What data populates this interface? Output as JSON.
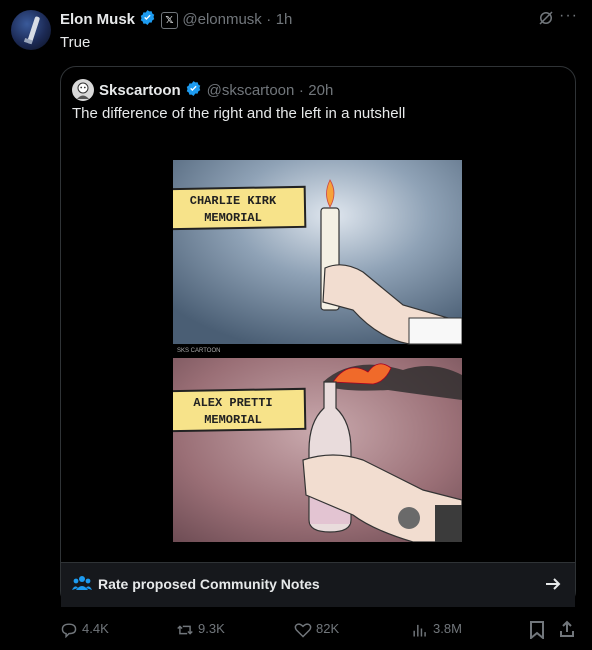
{
  "tweet": {
    "author_name": "Elon Musk",
    "x_badge": "𝕏",
    "handle": "@elonmusk",
    "dot": "·",
    "time": "1h",
    "text": "True",
    "more_icon": "ellipsis-icon",
    "grok_icon": "grok-icon"
  },
  "quote": {
    "author_name": "Skscartoon",
    "handle": "@skscartoon",
    "dot": "·",
    "time": "20h",
    "text": "The difference of the right and the left in a nutshell",
    "comic": {
      "panel1_label_line1": "CHARLIE KIRK",
      "panel1_label_line2": "MEMORIAL",
      "watermark": "SKS CARTOON",
      "panel2_label_line1": "ALEX PRETTI",
      "panel2_label_line2": "MEMORIAL"
    }
  },
  "community_notes": {
    "label": "Rate proposed Community Notes"
  },
  "actions": {
    "replies": "4.4K",
    "reposts": "9.3K",
    "likes": "82K",
    "views": "3.8M"
  },
  "colors": {
    "background": "#000000",
    "text": "#e7e9ea",
    "muted": "#71767b",
    "verified": "#1d9bf0",
    "label_yellow": "#f7e38a",
    "border": "#2f3336"
  }
}
